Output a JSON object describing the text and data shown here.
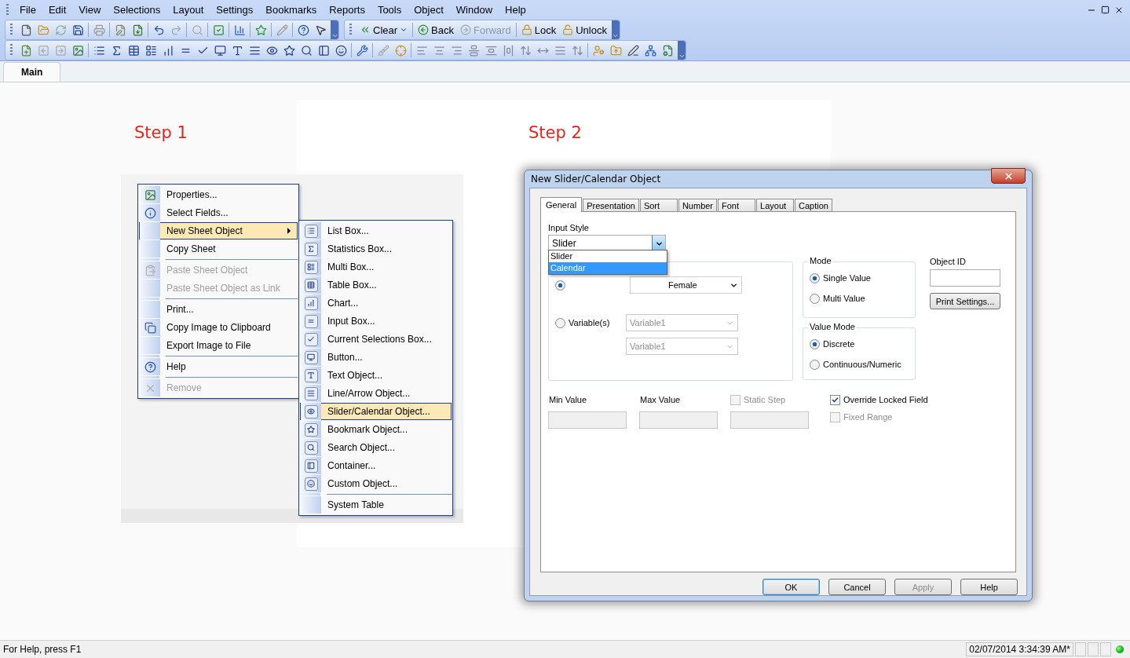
{
  "menu_bar": [
    "File",
    "Edit",
    "View",
    "Selections",
    "Layout",
    "Settings",
    "Bookmarks",
    "Reports",
    "Tools",
    "Object",
    "Window",
    "Help"
  ],
  "nav_toolbar": [
    {
      "label": "Clear",
      "kind": "dropdown",
      "disabled": false
    },
    {
      "label": "Back",
      "kind": "button",
      "disabled": false
    },
    {
      "label": "Forward",
      "kind": "button",
      "disabled": true
    },
    {
      "label": "Lock",
      "kind": "button",
      "disabled": false
    },
    {
      "label": "Unlock",
      "kind": "button",
      "disabled": false
    }
  ],
  "sheet_tabs": [
    {
      "label": "Main",
      "selected": true
    }
  ],
  "step_labels": [
    "Step 1",
    "Step 2"
  ],
  "context_menu": [
    {
      "label": "Properties...",
      "kind": "item",
      "disabled": false,
      "selected": false
    },
    {
      "label": "Select Fields...",
      "kind": "item",
      "disabled": false,
      "selected": false
    },
    {
      "label": "New Sheet Object",
      "kind": "submenu",
      "disabled": false,
      "selected": true
    },
    {
      "label": "Copy Sheet",
      "kind": "item",
      "disabled": false,
      "selected": false
    },
    {
      "kind": "separator"
    },
    {
      "label": "Paste Sheet Object",
      "kind": "item",
      "disabled": true,
      "selected": false
    },
    {
      "label": "Paste Sheet Object as Link",
      "kind": "item",
      "disabled": true,
      "selected": false
    },
    {
      "kind": "separator"
    },
    {
      "label": "Print...",
      "kind": "item",
      "disabled": false,
      "selected": false
    },
    {
      "label": "Copy Image to Clipboard",
      "kind": "item",
      "disabled": false,
      "selected": false
    },
    {
      "label": "Export Image to File",
      "kind": "item",
      "disabled": false,
      "selected": false
    },
    {
      "kind": "separator"
    },
    {
      "label": "Help",
      "kind": "item",
      "disabled": false,
      "selected": false
    },
    {
      "kind": "separator"
    },
    {
      "label": "Remove",
      "kind": "item",
      "disabled": true,
      "selected": false
    }
  ],
  "submenu": [
    {
      "label": "List Box...",
      "kind": "item",
      "selected": false
    },
    {
      "label": "Statistics Box...",
      "kind": "item",
      "selected": false
    },
    {
      "label": "Multi Box...",
      "kind": "item",
      "selected": false
    },
    {
      "label": "Table Box...",
      "kind": "item",
      "selected": false
    },
    {
      "label": "Chart...",
      "kind": "item",
      "selected": false
    },
    {
      "label": "Input Box...",
      "kind": "item",
      "selected": false
    },
    {
      "label": "Current Selections Box...",
      "kind": "item",
      "selected": false
    },
    {
      "label": "Button...",
      "kind": "item",
      "selected": false
    },
    {
      "label": "Text Object...",
      "kind": "item",
      "selected": false
    },
    {
      "label": "Line/Arrow Object...",
      "kind": "item",
      "selected": false
    },
    {
      "label": "Slider/Calendar Object...",
      "kind": "item",
      "selected": true
    },
    {
      "label": "Bookmark Object...",
      "kind": "item",
      "selected": false
    },
    {
      "label": "Search Object...",
      "kind": "item",
      "selected": false
    },
    {
      "label": "Container...",
      "kind": "item",
      "selected": false
    },
    {
      "label": "Custom Object...",
      "kind": "item",
      "selected": false
    },
    {
      "kind": "separator"
    },
    {
      "label": "System Table",
      "kind": "item",
      "selected": false
    }
  ],
  "dialog": {
    "title": "New Slider/Calendar Object",
    "tabs": [
      {
        "label": "General",
        "selected": true
      },
      {
        "label": "Presentation",
        "selected": false
      },
      {
        "label": "Sort",
        "selected": false
      },
      {
        "label": "Number",
        "selected": false
      },
      {
        "label": "Font",
        "selected": false
      },
      {
        "label": "Layout",
        "selected": false
      },
      {
        "label": "Caption",
        "selected": false
      }
    ],
    "input_style": {
      "label": "Input Style",
      "value": "Slider",
      "options": [
        {
          "label": "Slider",
          "highlighted": false
        },
        {
          "label": "Calendar",
          "highlighted": true
        }
      ]
    },
    "field_radio": {
      "selected": true
    },
    "field_value": "Female",
    "variable_radio": {
      "label": "Variable(s)",
      "selected": false
    },
    "variable_combos": [
      {
        "value": "Variable1",
        "disabled": true
      },
      {
        "value": "Variable1",
        "disabled": true
      }
    ],
    "mode": {
      "title": "Mode",
      "options": [
        {
          "label": "Single Value",
          "selected": true
        },
        {
          "label": "Multi Value",
          "selected": false
        }
      ]
    },
    "value_mode": {
      "title": "Value Mode",
      "options": [
        {
          "label": "Discrete",
          "selected": true
        },
        {
          "label": "Continuous/Numeric",
          "selected": false
        }
      ]
    },
    "object_id": {
      "label": "Object ID"
    },
    "print_settings": "Print Settings...",
    "range_fields": [
      {
        "label": "Min Value",
        "kind": "label"
      },
      {
        "label": "Max Value",
        "kind": "label"
      },
      {
        "label": "Static Step",
        "kind": "checkbox",
        "checked": false
      }
    ],
    "checkboxes": [
      {
        "label": "Override Locked Field",
        "checked": true,
        "disabled": false
      },
      {
        "label": "Fixed Range",
        "checked": false,
        "disabled": true
      }
    ],
    "buttons": [
      {
        "label": "OK",
        "default": true,
        "disabled": false
      },
      {
        "label": "Cancel",
        "default": false,
        "disabled": false
      },
      {
        "label": "Apply",
        "default": false,
        "disabled": true
      },
      {
        "label": "Help",
        "default": false,
        "disabled": false
      }
    ]
  },
  "status_bar": {
    "help": "For Help, press F1",
    "timestamp": "02/07/2014 3:34:39 AM*"
  }
}
